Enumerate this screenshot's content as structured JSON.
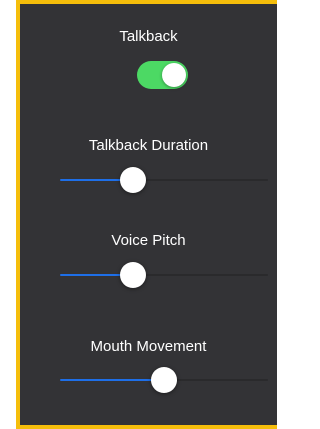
{
  "colors": {
    "frame_border": "#F5BE0B",
    "panel_background": "#333336",
    "toggle_on": "#4CD964",
    "slider_fill": "#1E6FE8",
    "slider_track": "#2A2A2C"
  },
  "talkback": {
    "label": "Talkback",
    "enabled": true
  },
  "sliders": [
    {
      "label": "Talkback Duration",
      "value": 0.35
    },
    {
      "label": "Voice Pitch",
      "value": 0.35
    },
    {
      "label": "Mouth Movement",
      "value": 0.5
    }
  ]
}
